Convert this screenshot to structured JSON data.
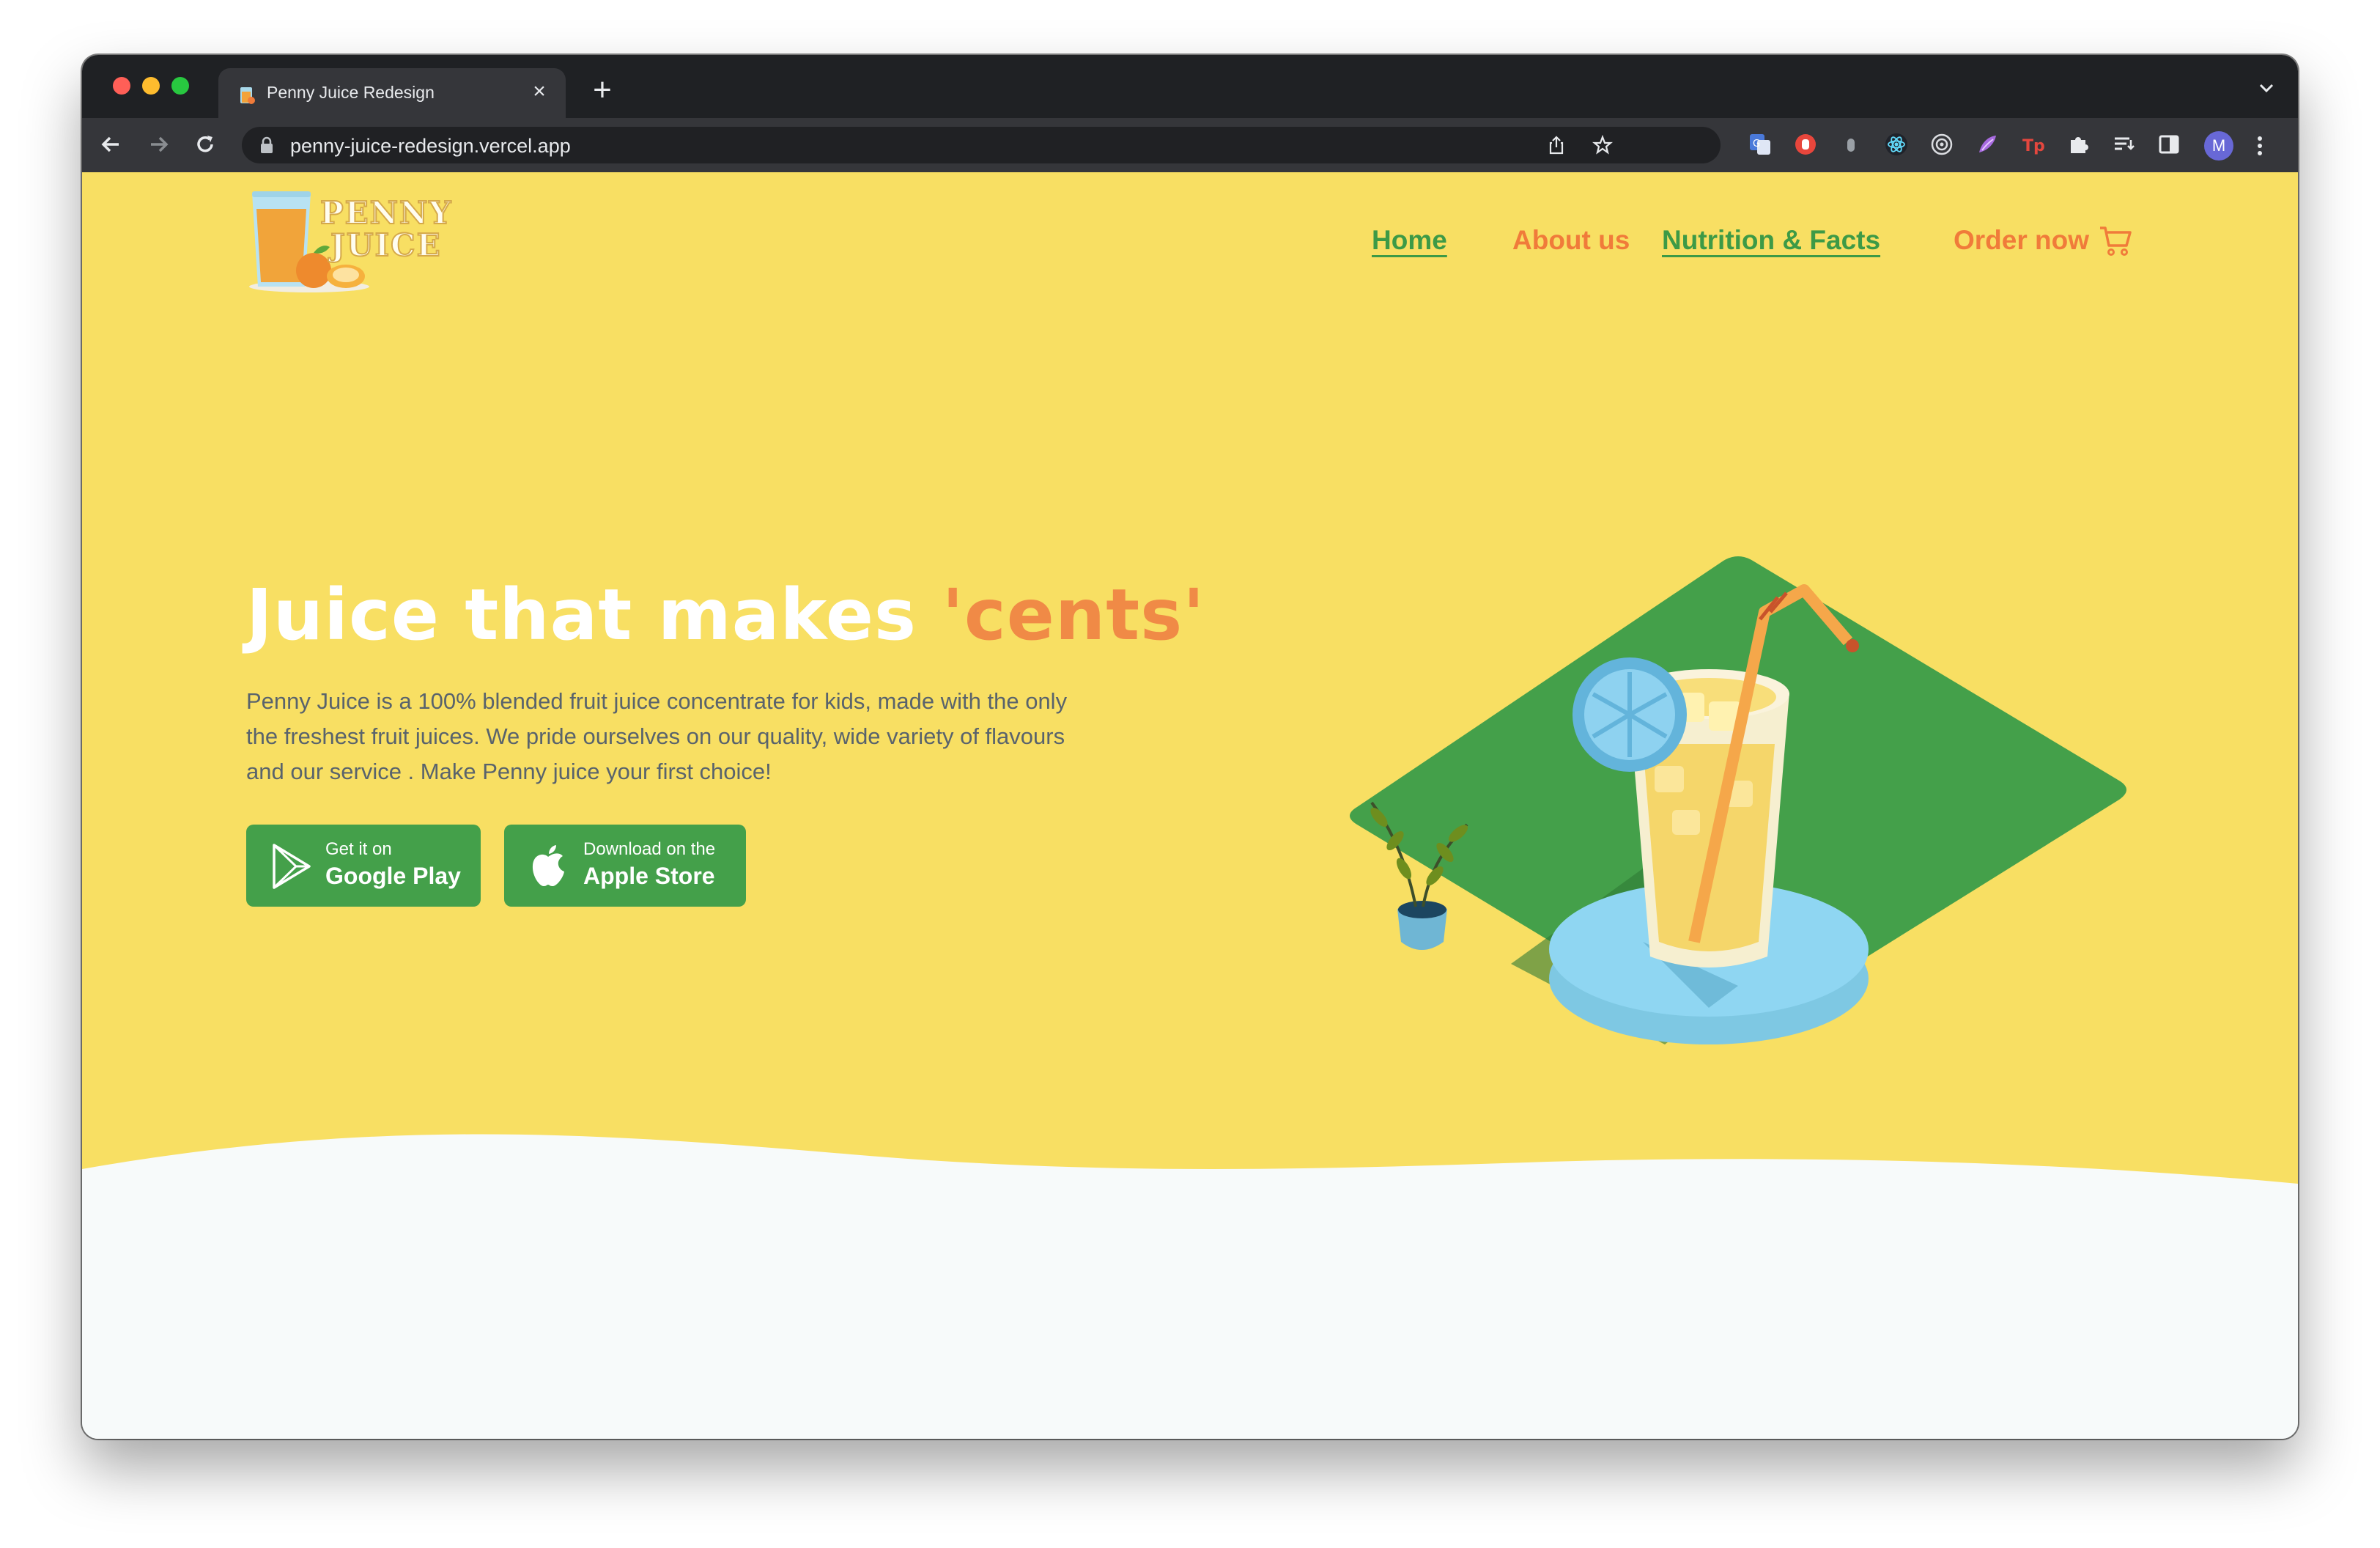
{
  "browser": {
    "tab_title": "Penny Juice Redesign",
    "tab_close": "×",
    "new_tab": "+",
    "url": "penny-juice-redesign.vercel.app",
    "profile_initial": "M",
    "extensions": [
      "translate-extension-icon",
      "adblock-extension-icon",
      "ghost-extension-icon",
      "react-devtools-icon",
      "target-extension-icon",
      "feather-extension-icon",
      "tp-extension-icon",
      "extensions-puzzle-icon",
      "reading-list-icon",
      "side-panel-icon"
    ]
  },
  "site": {
    "logo": {
      "line1": "PENNY",
      "line2": "JUICE"
    },
    "nav": {
      "home": "Home",
      "about": "About us",
      "nutrition": "Nutrition & Facts",
      "order": "Order now"
    },
    "hero": {
      "headline_main": "Juice that makes ",
      "headline_accent": "'cents'",
      "description": "Penny Juice is a 100% blended fruit juice concentrate for kids, made with the only the freshest fruit juices. We pride ourselves on our quality, wide variety of flavours and our service . Make Penny juice your first choice!",
      "google_small": "Get it on",
      "google_big": "Google Play",
      "apple_small": "Download on the",
      "apple_big": "Apple Store"
    }
  },
  "colors": {
    "hero_bg": "#f8df63",
    "brand_green": "#44a04a",
    "brand_orange": "#f07b3a",
    "nav_green": "#3d9a46"
  }
}
